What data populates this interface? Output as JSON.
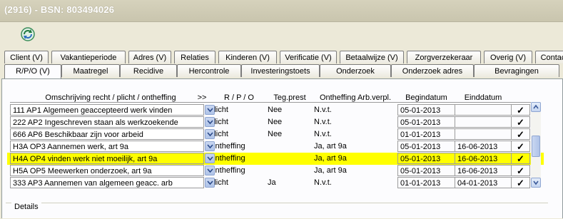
{
  "window": {
    "title": "(2916) - BSN: 803494026"
  },
  "toolbar": {
    "refresh_icon": "refresh-icon"
  },
  "tabs_row1": [
    "Client (V)",
    "Vakantieperiode",
    "Adres (V)",
    "Relaties",
    "Kinderen (V)",
    "Verificatie (V)",
    "Betaalwijze (V)",
    "Zorgverzekeraar",
    "Overig (V)",
    "Contac"
  ],
  "tabs_row2": [
    "R/P/O (V)",
    "Maatregel",
    "Recidive",
    "Hercontrole",
    "Investeringstoets",
    "Onderzoek",
    "Onderzoek adres",
    "Bevragingen"
  ],
  "active_tab": "R/P/O (V)",
  "grid": {
    "headers": {
      "omschrijving": "Omschrijving recht / plicht / ontheffing",
      "expand": ">>",
      "rpo": "R / P / O",
      "teg": "Teg.prest",
      "ont": "Ontheffing Arb.verpl.",
      "begin": "Begindatum",
      "eind": "Einddatum"
    },
    "rows": [
      {
        "omschrijving": "111 AP1 Algemeen geaccepteerd werk vinden",
        "rpo": "Plicht",
        "teg": "Nee",
        "ont": "N.v.t.",
        "begin": "05-01-2013",
        "eind": "",
        "check": "✓"
      },
      {
        "omschrijving": "222 AP2 Ingeschreven staan als werkzoekende",
        "rpo": "Plicht",
        "teg": "Nee",
        "ont": "N.v.t.",
        "begin": "05-01-2013",
        "eind": "",
        "check": "✓"
      },
      {
        "omschrijving": "666 AP6 Beschikbaar zijn voor arbeid",
        "rpo": "Plicht",
        "teg": "Nee",
        "ont": "N.v.t.",
        "begin": "01-01-2013",
        "eind": "",
        "check": "✓"
      },
      {
        "omschrijving": "H3A OP3 Aannemen werk, art 9a",
        "rpo": "Ontheffing",
        "teg": "",
        "ont": "Ja, art 9a",
        "begin": "05-01-2013",
        "eind": "16-06-2013",
        "check": "✓"
      },
      {
        "omschrijving": "H4A OP4 vinden werk niet moeilijk, art 9a",
        "rpo": "Ontheffing",
        "teg": "",
        "ont": "Ja, art 9a",
        "begin": "05-01-2013",
        "eind": "16-06-2013",
        "check": "✓",
        "highlight": true
      },
      {
        "omschrijving": "H5A OP5 Meewerken onderzoek, art 9a",
        "rpo": "Ontheffing",
        "teg": "",
        "ont": "Ja, art 9a",
        "begin": "05-01-2013",
        "eind": "16-06-2013",
        "check": "✓"
      },
      {
        "omschrijving": "333 AP3 Aannemen van algemeen geacc. arb",
        "rpo": "Plicht",
        "teg": "Ja",
        "ont": "N.v.t.",
        "begin": "01-01-2013",
        "eind": "04-01-2013",
        "check": "✓"
      }
    ]
  },
  "details": {
    "label": "Details"
  },
  "colors": {
    "highlight": "#FFFF00",
    "title_bg": "#D6D2BC",
    "panel_bg": "#FCFCFE"
  }
}
